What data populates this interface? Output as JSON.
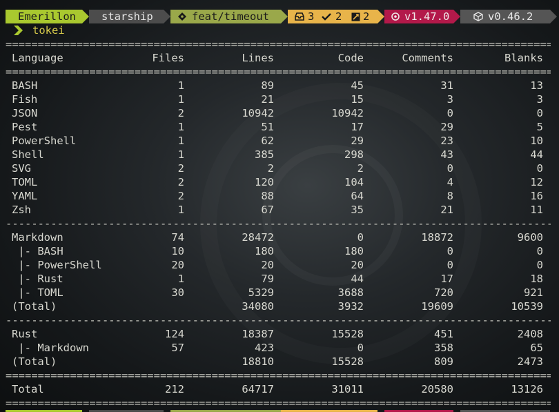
{
  "prompt": {
    "user": "Emerillon",
    "directory": "starship",
    "branch": "feat/timeout",
    "stash_count": "3",
    "staged_count": "2",
    "modified_count": "2",
    "rust_version": "v1.47.0",
    "package_version": "v0.46.2",
    "colors": {
      "user": "#a9c82f",
      "directory": "#4c4c4c",
      "branch": "#9aa84a",
      "git": "#e8b44a",
      "rust": "#b3194a",
      "package": "#555555"
    },
    "icons": {
      "branch": "git-branch-icon",
      "stash": "inbox-icon",
      "staged": "check-icon",
      "modified": "file-diff-icon",
      "rust": "rust-gear-icon",
      "package": "package-box-icon"
    }
  },
  "command": {
    "prompt_symbol_icon": "chevron-right-icon",
    "text": "tokei"
  },
  "separators": {
    "double": "==============================================================================================================",
    "single": "--------------------------------------------------------------------------------------------------------------"
  },
  "header": {
    "language": "Language",
    "files": "Files",
    "lines": "Lines",
    "code": "Code",
    "comments": "Comments",
    "blanks": "Blanks"
  },
  "languages": [
    {
      "language": "BASH",
      "files": "1",
      "lines": "89",
      "code": "45",
      "comments": "31",
      "blanks": "13"
    },
    {
      "language": "Fish",
      "files": "1",
      "lines": "21",
      "code": "15",
      "comments": "3",
      "blanks": "3"
    },
    {
      "language": "JSON",
      "files": "2",
      "lines": "10942",
      "code": "10942",
      "comments": "0",
      "blanks": "0"
    },
    {
      "language": "Pest",
      "files": "1",
      "lines": "51",
      "code": "17",
      "comments": "29",
      "blanks": "5"
    },
    {
      "language": "PowerShell",
      "files": "1",
      "lines": "62",
      "code": "29",
      "comments": "23",
      "blanks": "10"
    },
    {
      "language": "Shell",
      "files": "1",
      "lines": "385",
      "code": "298",
      "comments": "43",
      "blanks": "44"
    },
    {
      "language": "SVG",
      "files": "2",
      "lines": "2",
      "code": "2",
      "comments": "0",
      "blanks": "0"
    },
    {
      "language": "TOML",
      "files": "2",
      "lines": "120",
      "code": "104",
      "comments": "4",
      "blanks": "12"
    },
    {
      "language": "YAML",
      "files": "2",
      "lines": "88",
      "code": "64",
      "comments": "8",
      "blanks": "16"
    },
    {
      "language": "Zsh",
      "files": "1",
      "lines": "67",
      "code": "35",
      "comments": "21",
      "blanks": "11"
    }
  ],
  "markdown": [
    {
      "language": "Markdown",
      "files": "74",
      "lines": "28472",
      "code": "0",
      "comments": "18872",
      "blanks": "9600"
    },
    {
      "language": " |- BASH",
      "files": "10",
      "lines": "180",
      "code": "180",
      "comments": "0",
      "blanks": "0"
    },
    {
      "language": " |- PowerShell",
      "files": "20",
      "lines": "20",
      "code": "20",
      "comments": "0",
      "blanks": "0"
    },
    {
      "language": " |- Rust",
      "files": "1",
      "lines": "79",
      "code": "44",
      "comments": "17",
      "blanks": "18"
    },
    {
      "language": " |- TOML",
      "files": "30",
      "lines": "5329",
      "code": "3688",
      "comments": "720",
      "blanks": "921"
    },
    {
      "language": "(Total)",
      "files": "",
      "lines": "34080",
      "code": "3932",
      "comments": "19609",
      "blanks": "10539"
    }
  ],
  "rust": [
    {
      "language": "Rust",
      "files": "124",
      "lines": "18387",
      "code": "15528",
      "comments": "451",
      "blanks": "2408"
    },
    {
      "language": " |- Markdown",
      "files": "57",
      "lines": "423",
      "code": "0",
      "comments": "358",
      "blanks": "65"
    },
    {
      "language": "(Total)",
      "files": "",
      "lines": "18810",
      "code": "15528",
      "comments": "809",
      "blanks": "2473"
    }
  ],
  "total": {
    "language": "Total",
    "files": "212",
    "lines": "64717",
    "code": "31011",
    "comments": "20580",
    "blanks": "13126"
  }
}
